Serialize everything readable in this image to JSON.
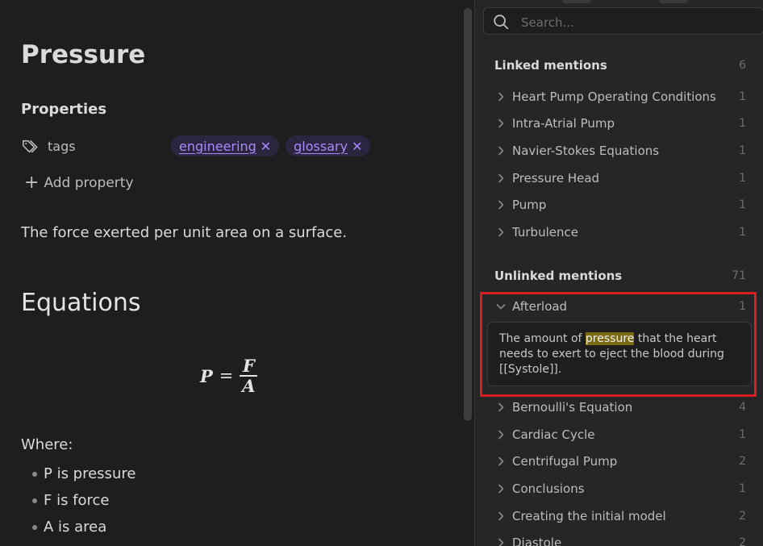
{
  "note": {
    "title": "Pressure",
    "properties_heading": "Properties",
    "property": {
      "name": "tags",
      "tags": [
        "engineering",
        "glossary"
      ],
      "remove_glyph": "✕"
    },
    "add_property_label": "Add property",
    "description": "The force exerted per unit area on a surface.",
    "equations_heading": "Equations",
    "equation": {
      "lhs": "P",
      "equals": "=",
      "numerator": "F",
      "denominator": "A"
    },
    "where_label": "Where:",
    "bullets": [
      "P is pressure",
      "F is force",
      "A is area"
    ]
  },
  "backlinks": {
    "search": {
      "placeholder": "Search...",
      "value": ""
    },
    "linked": {
      "label": "Linked mentions",
      "count": "6",
      "items": [
        {
          "name": "Heart Pump Operating Conditions",
          "count": "1"
        },
        {
          "name": "Intra-Atrial Pump",
          "count": "1"
        },
        {
          "name": "Navier-Stokes Equations",
          "count": "1"
        },
        {
          "name": "Pressure Head",
          "count": "1"
        },
        {
          "name": "Pump",
          "count": "1"
        },
        {
          "name": "Turbulence",
          "count": "1"
        }
      ]
    },
    "unlinked": {
      "label": "Unlinked mentions",
      "count": "71",
      "expanded": {
        "name": "Afterload",
        "count": "1",
        "snippet_before": "The amount of ",
        "snippet_match": "pressure",
        "snippet_after": " that the heart needs to exert to eject the blood during [[Systole]]."
      },
      "items": [
        {
          "name": "Bernoulli's Equation",
          "count": "4"
        },
        {
          "name": "Cardiac Cycle",
          "count": "1"
        },
        {
          "name": "Centrifugal Pump",
          "count": "2"
        },
        {
          "name": "Conclusions",
          "count": "1"
        },
        {
          "name": "Creating the initial model",
          "count": "2"
        },
        {
          "name": "Diastole",
          "count": "2"
        }
      ]
    }
  },
  "colors": {
    "tag_text": "#a88bfa",
    "tag_bg": "#2b2540",
    "search_highlight": "#7a6a13",
    "annotation_box": "#d81e1e"
  },
  "icons": {
    "tags": "tags-icon",
    "add": "plus-icon",
    "search": "search-icon",
    "collapsed": "chevron-right-icon",
    "expanded": "chevron-down-icon"
  }
}
